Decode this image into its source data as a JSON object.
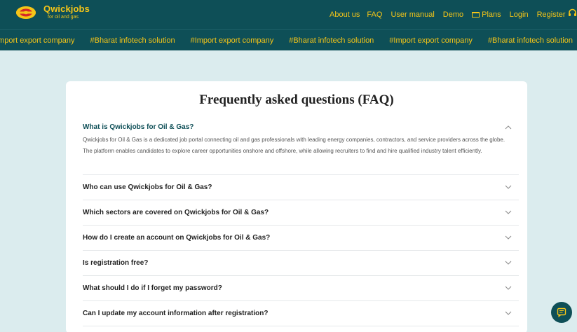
{
  "brand": {
    "name": "Qwickjobs",
    "tagline": "for oil and gas"
  },
  "nav": {
    "about": "About us",
    "faq": "FAQ",
    "manual": "User manual",
    "demo": "Demo",
    "plans": "Plans",
    "login": "Login",
    "register": "Register"
  },
  "marquee": [
    "Import export company",
    "#Bharat infotech solution",
    "#Import export company",
    "#Bharat infotech solution",
    "#Import export company",
    "#Bharat infotech solution"
  ],
  "faq": {
    "title": "Frequently asked questions (FAQ)",
    "items": [
      {
        "question": "What is Qwickjobs for Oil & Gas?",
        "answer": "Qwickjobs for Oil & Gas is a dedicated job portal connecting oil and gas professionals with leading energy companies, contractors, and service providers across the globe. The platform enables candidates to explore career opportunities onshore and offshore, while allowing recruiters to find and hire qualified industry talent efficiently.",
        "expanded": true
      },
      {
        "question": "Who can use Qwickjobs for Oil & Gas?",
        "expanded": false
      },
      {
        "question": "Which sectors are covered on Qwickjobs for Oil & Gas?",
        "expanded": false
      },
      {
        "question": "How do I create an account on Qwickjobs for Oil & Gas?",
        "expanded": false
      },
      {
        "question": "Is registration free?",
        "expanded": false
      },
      {
        "question": "What should I do if I forget my password?",
        "expanded": false
      },
      {
        "question": "Can I update my account information after registration?",
        "expanded": false
      }
    ]
  },
  "colors": {
    "header_bg": "#0e4f57",
    "accent": "#f5c518",
    "page_bg": "#dbecee"
  },
  "icons": {
    "logo": "qwickjobs-logo-icon",
    "plans": "plans-card-icon",
    "support": "headset-icon",
    "chat": "chat-icon",
    "expand": "chevron-down-icon",
    "collapse": "chevron-up-icon"
  }
}
